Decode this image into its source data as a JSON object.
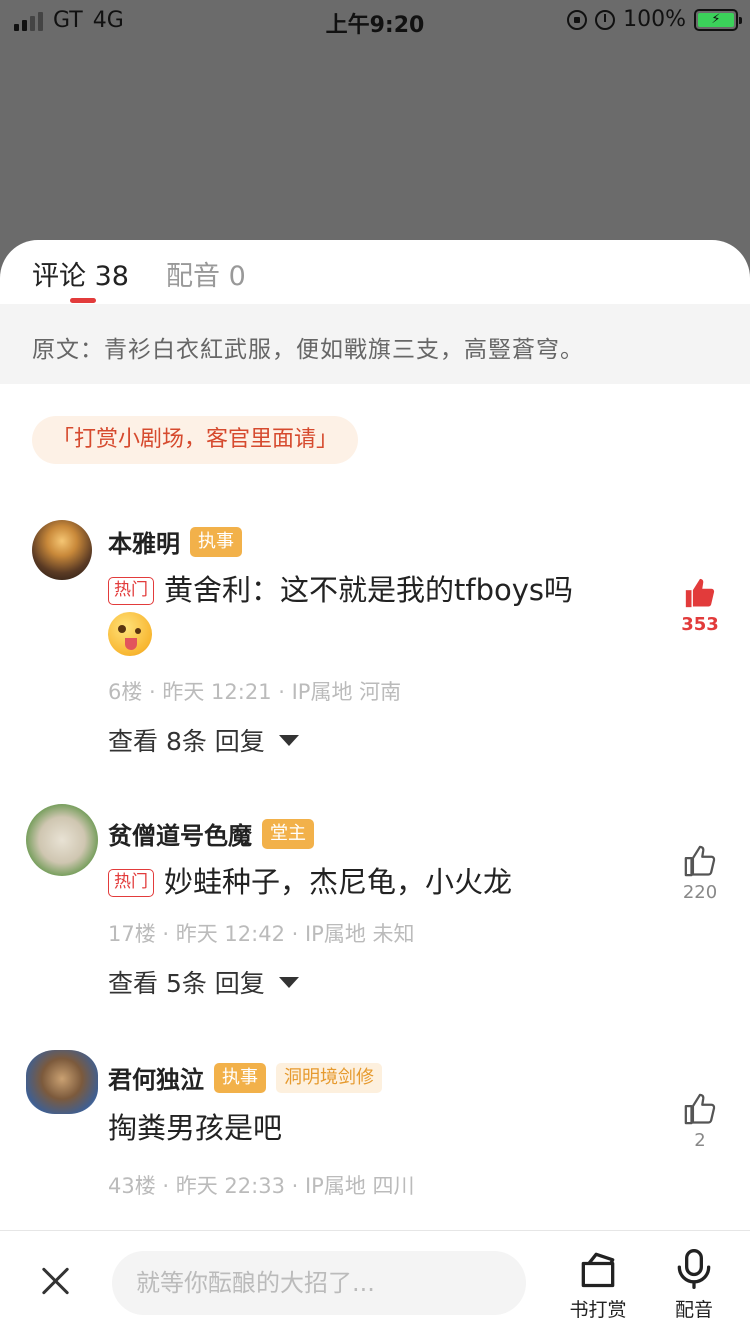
{
  "status_bar": {
    "carrier": "GT",
    "network": "4G",
    "time": "上午9:20",
    "battery": "100%",
    "colors": {
      "battery_fill": "#3bd15a"
    }
  },
  "tabs": [
    {
      "label": "评论 38",
      "active": true
    },
    {
      "label": "配音 0",
      "active": false
    }
  ],
  "original_text": "原文：青衫白衣紅武服，便如戰旗三支，高豎蒼穹。",
  "reward_banner": "「打赏小剧场，客官里面请」",
  "comments": [
    {
      "username": "本雅明",
      "badges": [
        "执事"
      ],
      "hot_label": "热门",
      "text": "黄舍利：这不就是我的tfboys吗",
      "has_emoji": true,
      "meta": "6楼 · 昨天 12:21 · IP属地 河南",
      "replies_label": "查看 8条 回复",
      "likes": "353",
      "liked": true
    },
    {
      "username": "贫僧道号色魔",
      "badges": [
        "堂主"
      ],
      "hot_label": "热门",
      "text": "妙蛙种子，杰尼龟，小火龙",
      "has_emoji": false,
      "meta": "17楼 · 昨天 12:42 · IP属地 未知",
      "replies_label": "查看 5条 回复",
      "likes": "220",
      "liked": false
    },
    {
      "username": "君何独泣",
      "badges": [
        "执事",
        "洞明境剑修"
      ],
      "text": "掏粪男孩是吧",
      "meta": "43楼 · 昨天 22:33 · IP属地 四川",
      "likes": "2",
      "liked": false
    }
  ],
  "bottom_bar": {
    "input_placeholder": "就等你酝酿的大招了...",
    "reward_label": "书打赏",
    "dub_label": "配音"
  },
  "colors": {
    "accent_red": "#e23b3b",
    "badge_orange": "#f2b14a",
    "overlay_gray": "#6b6b6b"
  }
}
